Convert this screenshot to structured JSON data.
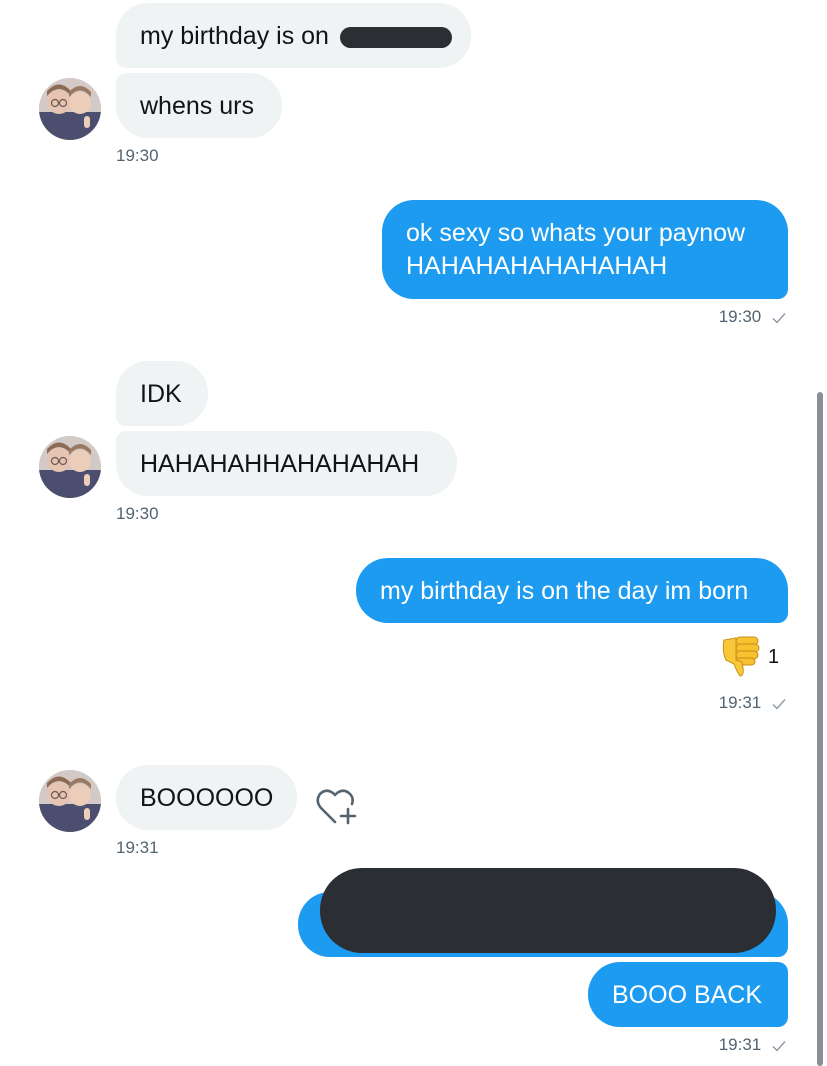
{
  "messages": {
    "m1": {
      "text": "my birthday is on"
    },
    "m2": {
      "text": "whens urs",
      "time": "19:30"
    },
    "m3": {
      "line1": "ok sexy so whats your paynow",
      "line2": "HAHAHAHAHAHAHAH",
      "time": "19:30"
    },
    "m4": {
      "text": "IDK"
    },
    "m5": {
      "text": "HAHAHAHHAHAHAHAH",
      "time": "19:30"
    },
    "m6": {
      "text": "my birthday is on the day im born",
      "reaction_count": "1",
      "time": "19:31"
    },
    "m7": {
      "text": "BOOOOOO",
      "time": "19:31"
    },
    "m9": {
      "text": "BOOO BACK",
      "time": "19:31"
    }
  },
  "icons": {
    "reaction": "thumbs-down-icon",
    "react": "heart-plus-icon",
    "read": "check-icon",
    "avatar": "avatar"
  },
  "colors": {
    "sent_bubble": "#1d9bf0",
    "received_bubble": "#eff3f4",
    "timestamp": "#536471",
    "redaction": "#2b2f33"
  }
}
